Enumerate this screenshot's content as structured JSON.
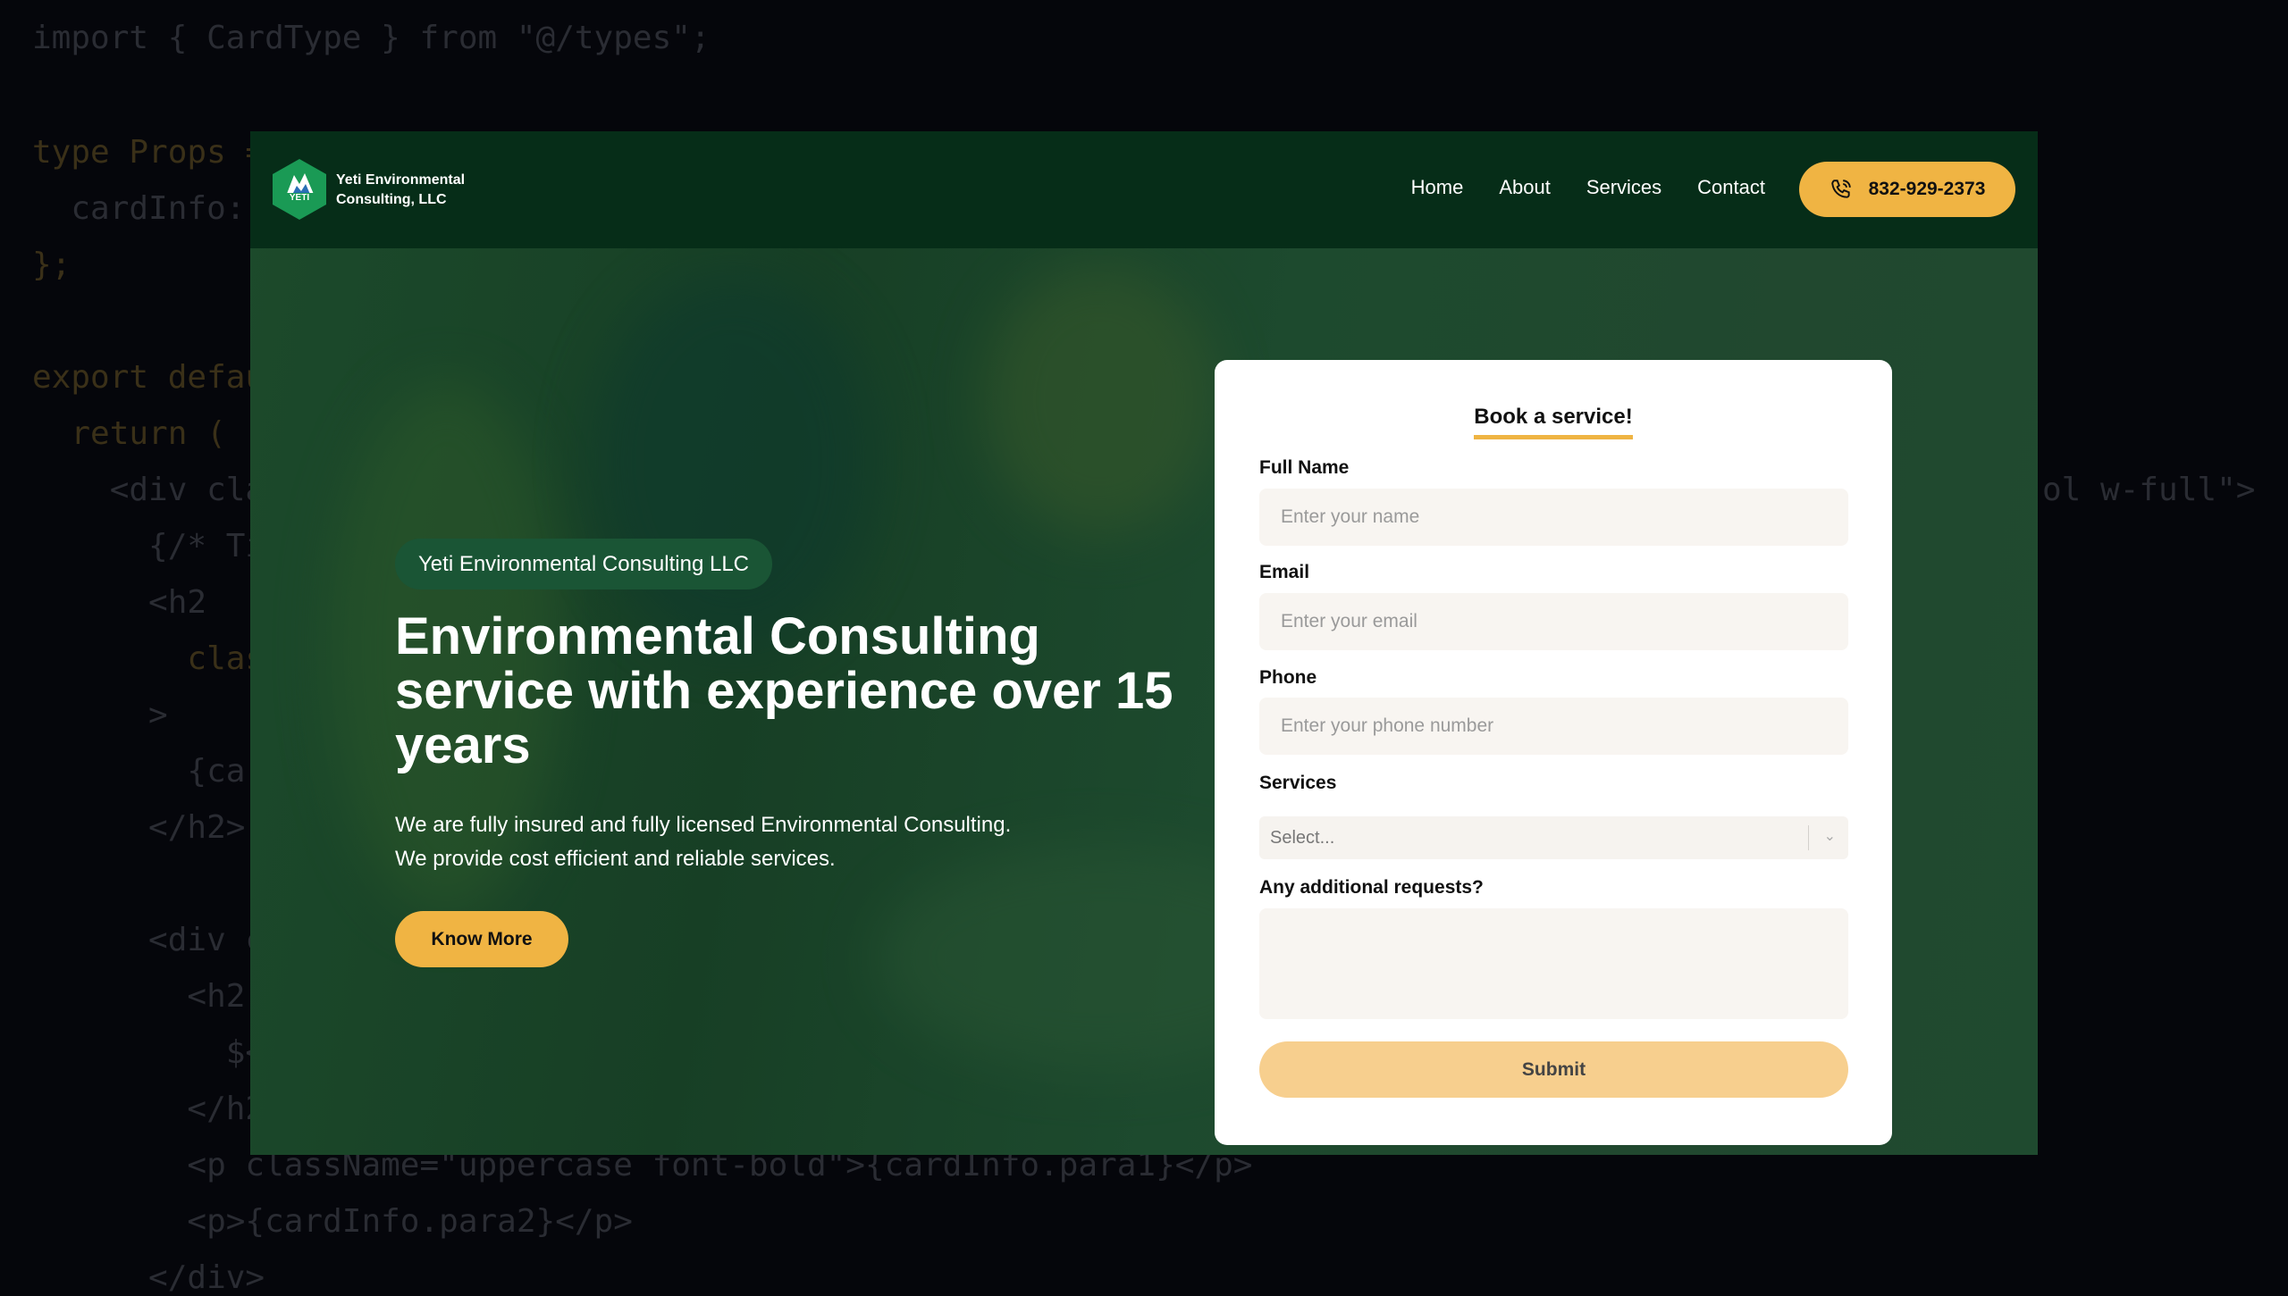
{
  "background_code": [
    "import { CardType } from \"@/types\";",
    "type Props =",
    "  cardInfo:",
    "};",
    "export defau",
    "  return (",
    "    <div cla",
    "      {/* Ti",
    "      <h2",
    "        clas",
    "      >",
    "        {car",
    "      </h2>",
    "      <div c",
    "        <h2",
    "          $<",
    "        </h2",
    "        <p className=\"uppercase font-bold\">{cardInfo.para1}</p>",
    "        <p>{cardInfo.para2}</p>",
    "      </div>",
    "ol w-full\">"
  ],
  "nav": {
    "logo_text_line1": "Yeti Environmental",
    "logo_text_line2": "Consulting, LLC",
    "logo_lettering": "YETI",
    "links": [
      "Home",
      "About",
      "Services",
      "Contact"
    ],
    "phone": "832-929-2373",
    "phone_icon": "phone-icon"
  },
  "hero": {
    "badge": "Yeti Environmental Consulting LLC",
    "title": "Environmental Consulting service with experience over 15 years",
    "text_line1": "We are fully insured and fully licensed Environmental Consulting.",
    "text_line2": "We provide cost efficient and reliable services.",
    "cta": "Know More"
  },
  "form": {
    "title": "Book a service!",
    "full_name_label": "Full Name",
    "full_name_placeholder": "Enter your name",
    "email_label": "Email",
    "email_placeholder": "Enter your email",
    "phone_label": "Phone",
    "phone_placeholder": "Enter your phone number",
    "services_label": "Services",
    "services_value": "Select...",
    "requests_label": "Any additional requests?",
    "submit": "Submit"
  },
  "colors": {
    "nav_bg": "#062d18",
    "accent": "#f0b443",
    "hero_overlay": "#1c4a2b",
    "badge_bg": "#1a5535"
  }
}
